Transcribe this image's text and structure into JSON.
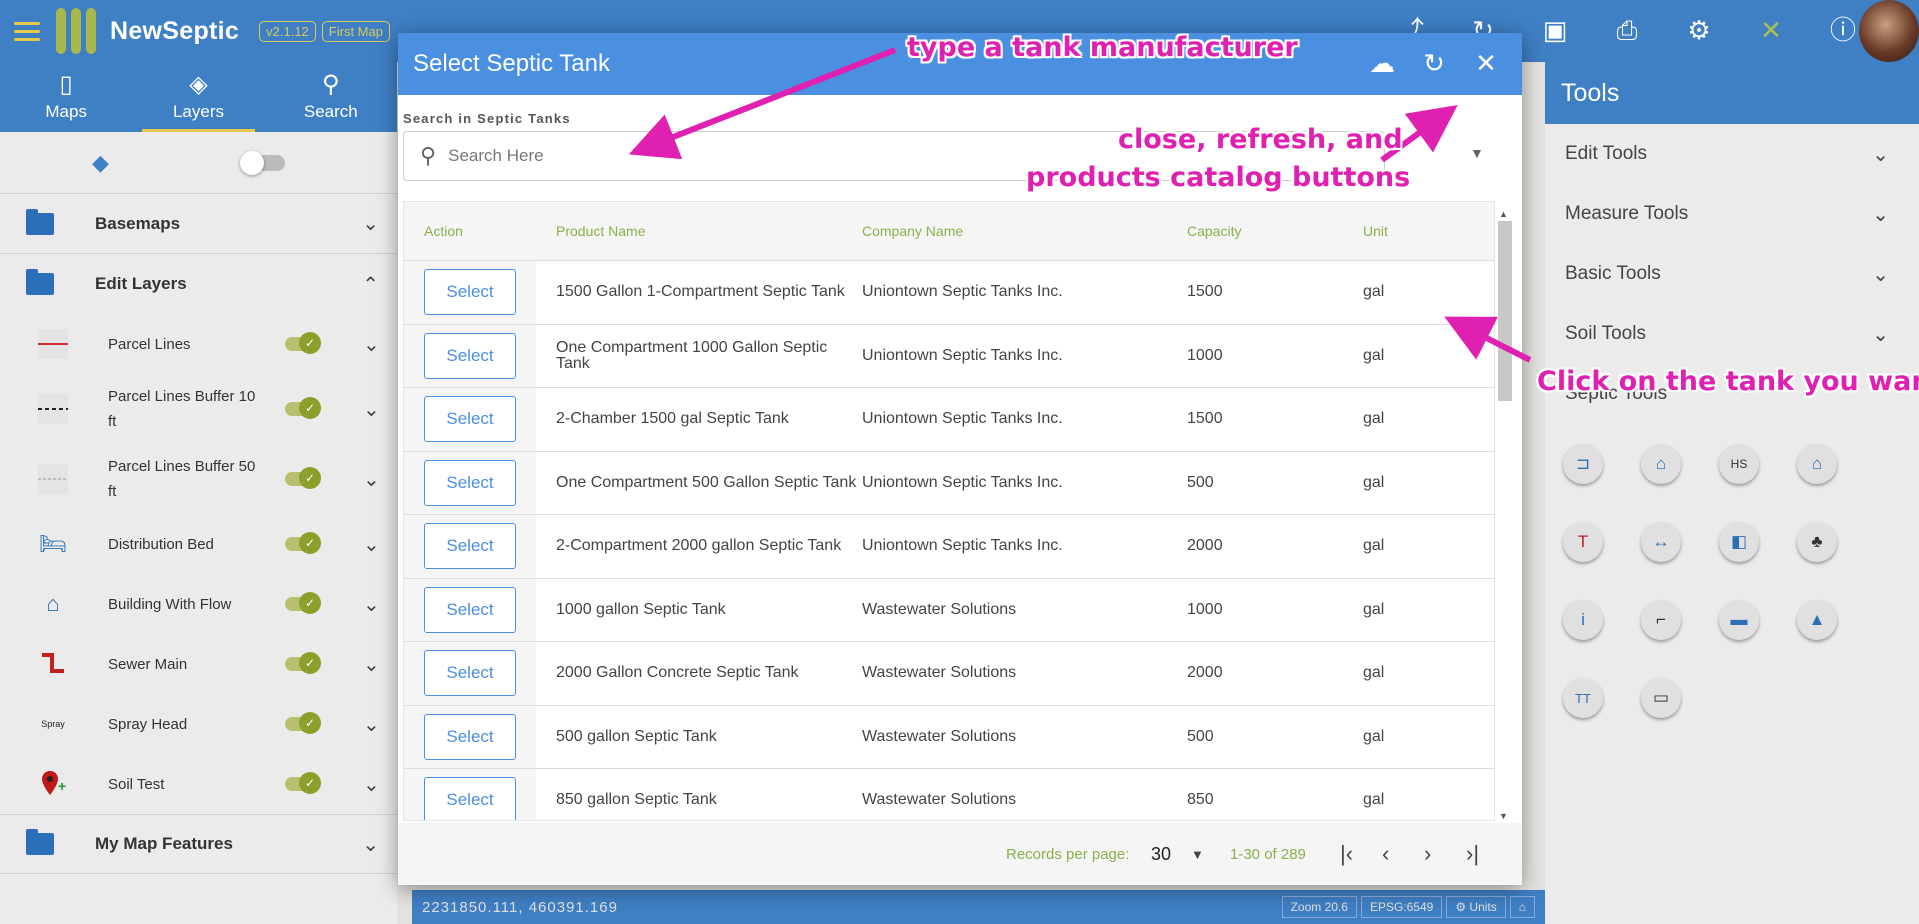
{
  "app": {
    "name": "NewSeptic",
    "version": "v2.1.12",
    "map_name": "First Map"
  },
  "topbar": {
    "icons": [
      "share-icon",
      "refresh-icon",
      "save-icon",
      "print-icon",
      "settings-icon",
      "tools-icon",
      "info-icon"
    ]
  },
  "nav": {
    "tabs": [
      {
        "label": "Maps"
      },
      {
        "label": "Layers"
      },
      {
        "label": "Search"
      }
    ]
  },
  "layers": {
    "basemaps": "Basemaps",
    "edit_layers": "Edit Layers",
    "items": [
      {
        "label": "Parcel Lines"
      },
      {
        "label": "Parcel Lines Buffer 10 ft"
      },
      {
        "label": "Parcel Lines Buffer 50 ft"
      },
      {
        "label": "Distribution Bed"
      },
      {
        "label": "Building With Flow"
      },
      {
        "label": "Sewer Main"
      },
      {
        "label": "Spray Head"
      },
      {
        "label": "Soil Test"
      }
    ],
    "spray_icon_text": "Spray",
    "my_map_features": "My Map Features"
  },
  "tools": {
    "title": "Tools",
    "items": [
      "Edit Tools",
      "Measure Tools",
      "Basic Tools",
      "Soil Tools",
      "Septic Tools"
    ]
  },
  "status": {
    "coords": "2231850.111, 460391.169",
    "zoom": "Zoom 20.6",
    "epsg": "EPSG:6549",
    "units": "Units"
  },
  "modal": {
    "title": "Select Septic Tank",
    "search_label": "Search in Septic Tanks",
    "search_placeholder": "Search Here",
    "columns": {
      "action": "Action",
      "product": "Product Name",
      "company": "Company Name",
      "capacity": "Capacity",
      "unit": "Unit"
    },
    "select_label": "Select",
    "rows": [
      {
        "product": "1500 Gallon 1-Compartment Septic Tank",
        "company": "Uniontown Septic Tanks Inc.",
        "capacity": "1500",
        "unit": "gal"
      },
      {
        "product": "One Compartment 1000 Gallon Septic Tank",
        "company": "Uniontown Septic Tanks Inc.",
        "capacity": "1000",
        "unit": "gal"
      },
      {
        "product": "2-Chamber 1500 gal Septic Tank",
        "company": "Uniontown Septic Tanks Inc.",
        "capacity": "1500",
        "unit": "gal"
      },
      {
        "product": "One Compartment 500 Gallon Septic Tank",
        "company": "Uniontown Septic Tanks Inc.",
        "capacity": "500",
        "unit": "gal"
      },
      {
        "product": "2-Compartment 2000 gallon Septic Tank",
        "company": "Uniontown Septic Tanks Inc.",
        "capacity": "2000",
        "unit": "gal"
      },
      {
        "product": "1000 gallon Septic Tank",
        "company": "Wastewater Solutions",
        "capacity": "1000",
        "unit": "gal"
      },
      {
        "product": "2000 Gallon Concrete Septic Tank",
        "company": "Wastewater Solutions",
        "capacity": "2000",
        "unit": "gal"
      },
      {
        "product": "500 gallon Septic Tank",
        "company": "Wastewater Solutions",
        "capacity": "500",
        "unit": "gal"
      },
      {
        "product": "850 gallon Septic Tank",
        "company": "Wastewater Solutions",
        "capacity": "850",
        "unit": "gal"
      }
    ],
    "footer": {
      "records_per_page_label": "Records per page:",
      "records_per_page": "30",
      "range": "1-30 of 289"
    }
  },
  "annotations": {
    "manufacturer": "type a tank manufacturer",
    "buttons_line1": "close, refresh, and",
    "buttons_line2": "products catalog buttons",
    "click": "Click on the tank you want"
  },
  "colors": {
    "primary": "#3f7fc4",
    "modal_header": "#4a8fe0",
    "accent": "#e8c84a",
    "annotation": "#e020b0",
    "toggle_on": "#8aa02a"
  }
}
